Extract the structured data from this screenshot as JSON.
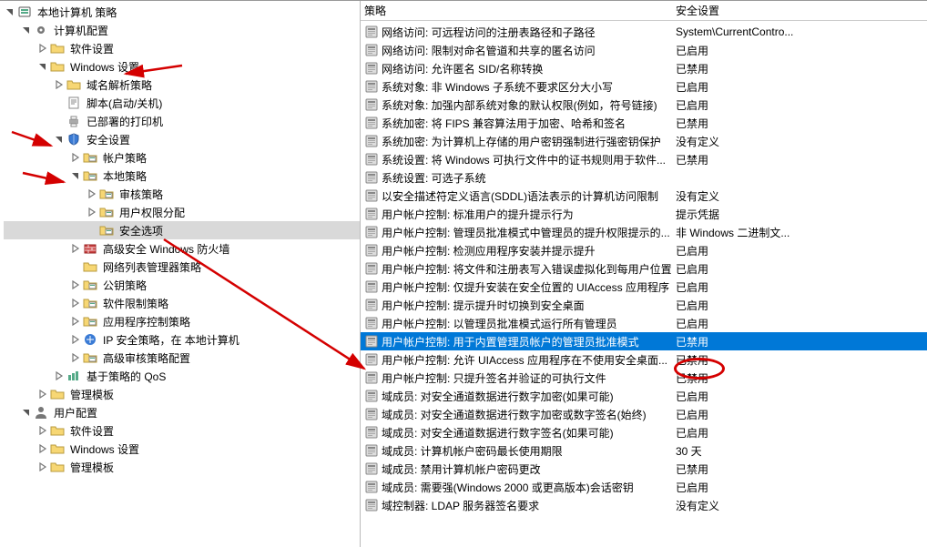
{
  "columns": {
    "policy": "策略",
    "setting": "安全设置"
  },
  "tree": [
    {
      "depth": 0,
      "exp": "open",
      "icon": "root",
      "label": "本地计算机 策略"
    },
    {
      "depth": 1,
      "exp": "open",
      "icon": "gear",
      "label": "计算机配置"
    },
    {
      "depth": 2,
      "exp": "closed",
      "icon": "folder",
      "label": "软件设置"
    },
    {
      "depth": 2,
      "exp": "open",
      "icon": "folder",
      "label": "Windows 设置"
    },
    {
      "depth": 3,
      "exp": "closed",
      "icon": "folder",
      "label": "域名解析策略"
    },
    {
      "depth": 3,
      "exp": "none",
      "icon": "script",
      "label": "脚本(启动/关机)"
    },
    {
      "depth": 3,
      "exp": "none",
      "icon": "printer",
      "label": "已部署的打印机"
    },
    {
      "depth": 3,
      "exp": "open",
      "icon": "shield",
      "label": "安全设置"
    },
    {
      "depth": 4,
      "exp": "closed",
      "icon": "folderg",
      "label": "帐户策略"
    },
    {
      "depth": 4,
      "exp": "open",
      "icon": "folderg",
      "label": "本地策略"
    },
    {
      "depth": 5,
      "exp": "closed",
      "icon": "folderg",
      "label": "审核策略"
    },
    {
      "depth": 5,
      "exp": "closed",
      "icon": "folderg",
      "label": "用户权限分配"
    },
    {
      "depth": 5,
      "exp": "none",
      "icon": "folderg",
      "label": "安全选项",
      "selected": true
    },
    {
      "depth": 4,
      "exp": "closed",
      "icon": "firewall",
      "label": "高级安全 Windows 防火墙"
    },
    {
      "depth": 4,
      "exp": "none",
      "icon": "folder",
      "label": "网络列表管理器策略"
    },
    {
      "depth": 4,
      "exp": "closed",
      "icon": "folderg",
      "label": "公钥策略"
    },
    {
      "depth": 4,
      "exp": "closed",
      "icon": "folderg",
      "label": "软件限制策略"
    },
    {
      "depth": 4,
      "exp": "closed",
      "icon": "folderg",
      "label": "应用程序控制策略"
    },
    {
      "depth": 4,
      "exp": "closed",
      "icon": "ipsec",
      "label": "IP 安全策略，在 本地计算机"
    },
    {
      "depth": 4,
      "exp": "closed",
      "icon": "folderg",
      "label": "高级审核策略配置"
    },
    {
      "depth": 3,
      "exp": "closed",
      "icon": "qos",
      "label": "基于策略的 QoS"
    },
    {
      "depth": 2,
      "exp": "closed",
      "icon": "folder",
      "label": "管理模板"
    },
    {
      "depth": 1,
      "exp": "open",
      "icon": "user",
      "label": "用户配置"
    },
    {
      "depth": 2,
      "exp": "closed",
      "icon": "folder",
      "label": "软件设置"
    },
    {
      "depth": 2,
      "exp": "closed",
      "icon": "folder",
      "label": "Windows 设置"
    },
    {
      "depth": 2,
      "exp": "closed",
      "icon": "folder",
      "label": "管理模板"
    }
  ],
  "policies": [
    {
      "name": "网络访问: 可远程访问的注册表路径和子路径",
      "setting": "System\\CurrentContro..."
    },
    {
      "name": "网络访问: 限制对命名管道和共享的匿名访问",
      "setting": "已启用"
    },
    {
      "name": "网络访问: 允许匿名 SID/名称转换",
      "setting": "已禁用"
    },
    {
      "name": "系统对象: 非 Windows 子系统不要求区分大小写",
      "setting": "已启用"
    },
    {
      "name": "系统对象: 加强内部系统对象的默认权限(例如，符号链接)",
      "setting": "已启用"
    },
    {
      "name": "系统加密: 将 FIPS 兼容算法用于加密、哈希和签名",
      "setting": "已禁用"
    },
    {
      "name": "系统加密: 为计算机上存储的用户密钥强制进行强密钥保护",
      "setting": "没有定义"
    },
    {
      "name": "系统设置: 将 Windows 可执行文件中的证书规则用于软件...",
      "setting": "已禁用"
    },
    {
      "name": "系统设置: 可选子系统",
      "setting": ""
    },
    {
      "name": "以安全描述符定义语言(SDDL)语法表示的计算机访问限制",
      "setting": "没有定义"
    },
    {
      "name": "用户帐户控制: 标准用户的提升提示行为",
      "setting": "提示凭据"
    },
    {
      "name": "用户帐户控制: 管理员批准模式中管理员的提升权限提示的...",
      "setting": "非 Windows 二进制文..."
    },
    {
      "name": "用户帐户控制: 检测应用程序安装并提示提升",
      "setting": "已启用"
    },
    {
      "name": "用户帐户控制: 将文件和注册表写入错误虚拟化到每用户位置",
      "setting": "已启用"
    },
    {
      "name": "用户帐户控制: 仅提升安装在安全位置的 UIAccess 应用程序",
      "setting": "已启用"
    },
    {
      "name": "用户帐户控制: 提示提升时切换到安全桌面",
      "setting": "已启用"
    },
    {
      "name": "用户帐户控制: 以管理员批准模式运行所有管理员",
      "setting": "已启用"
    },
    {
      "name": "用户帐户控制: 用于内置管理员帐户的管理员批准模式",
      "setting": "已禁用",
      "selected": true
    },
    {
      "name": "用户帐户控制: 允许 UIAccess 应用程序在不使用安全桌面...",
      "setting": "已禁用"
    },
    {
      "name": "用户帐户控制: 只提升签名并验证的可执行文件",
      "setting": "已禁用"
    },
    {
      "name": "域成员: 对安全通道数据进行数字加密(如果可能)",
      "setting": "已启用"
    },
    {
      "name": "域成员: 对安全通道数据进行数字加密或数字签名(始终)",
      "setting": "已启用"
    },
    {
      "name": "域成员: 对安全通道数据进行数字签名(如果可能)",
      "setting": "已启用"
    },
    {
      "name": "域成员: 计算机帐户密码最长使用期限",
      "setting": "30 天"
    },
    {
      "name": "域成员: 禁用计算机帐户密码更改",
      "setting": "已禁用"
    },
    {
      "name": "域成员: 需要强(Windows 2000 或更高版本)会话密钥",
      "setting": "已启用"
    },
    {
      "name": "域控制器: LDAP 服务器签名要求",
      "setting": "没有定义"
    }
  ]
}
